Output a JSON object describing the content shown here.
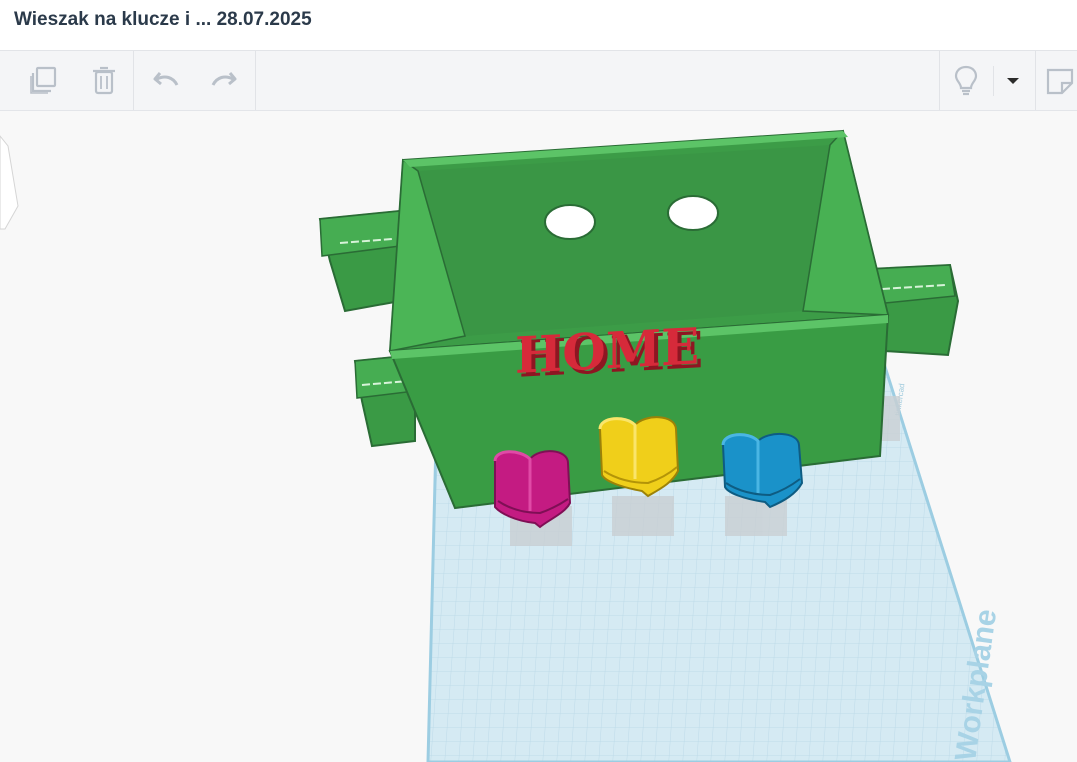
{
  "app": {
    "title": "Wieszak na klucze i ... 28.07.2025"
  },
  "toolbar": {
    "buttons": [
      {
        "name": "copy-icon"
      },
      {
        "name": "delete-icon"
      },
      {
        "name": "undo-icon"
      },
      {
        "name": "redo-icon"
      },
      {
        "name": "lightbulb-icon"
      },
      {
        "name": "dropdown-caret-icon"
      },
      {
        "name": "note-icon"
      }
    ]
  },
  "scene": {
    "model_text": "HOME",
    "workplane_label": "Workplane",
    "workplane_brand": "tinkercad",
    "colors": {
      "box_green": "#3fa64a",
      "box_dark": "#2a7a33",
      "home_red": "#d62a3a",
      "heart_magenta": "#cf1f8a",
      "heart_yellow": "#f2d21c",
      "heart_blue": "#1d95cc",
      "workplane": "#d5eaf3",
      "grid": "#b8d7e6"
    }
  }
}
